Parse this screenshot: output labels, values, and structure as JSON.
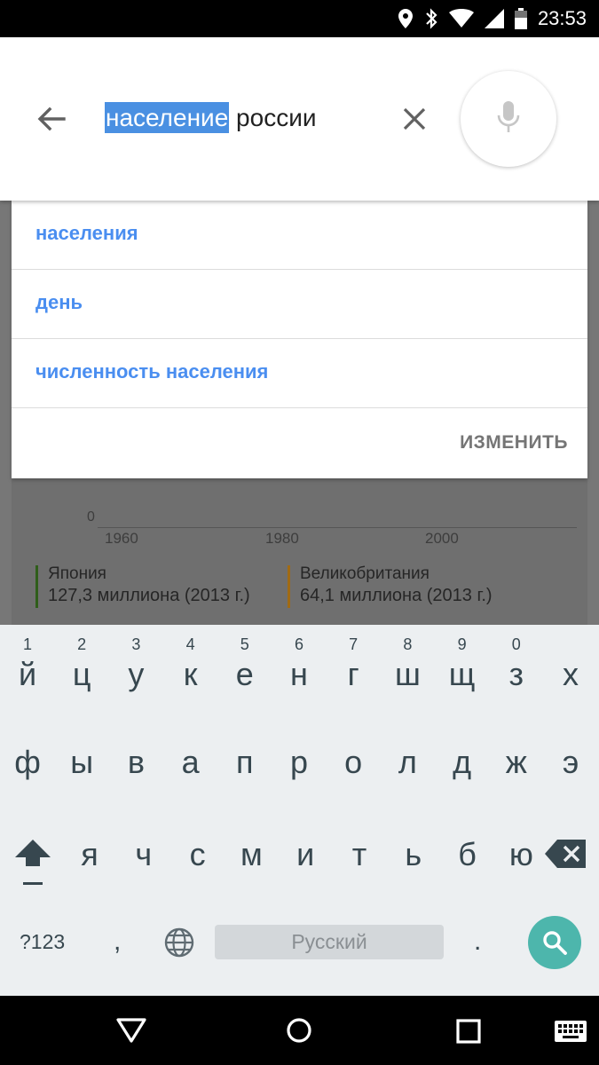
{
  "status_bar": {
    "time": "23:53",
    "icons": [
      "location-icon",
      "bluetooth-icon",
      "wifi-icon",
      "signal-icon",
      "battery-icon"
    ]
  },
  "search": {
    "query_selected": "население",
    "query_rest": " россии",
    "highlight_color": "#4a90e2"
  },
  "suggestions": {
    "items": [
      {
        "label": "населения"
      },
      {
        "label": "день"
      },
      {
        "label": "численность населения"
      }
    ],
    "edit_label": "ИЗМЕНИТЬ",
    "link_color": "#4a8ef0"
  },
  "background_chart": {
    "y_zero_label": "0",
    "x_ticks": [
      "1960",
      "1980",
      "2000"
    ],
    "legend": [
      {
        "name": "Япония",
        "value": "127,3 миллиона (2013 г.)",
        "color": "#2f5e1a"
      },
      {
        "name": "Великобритания",
        "value": "64,1 миллиона (2013 г.)",
        "color": "#a06a14"
      }
    ]
  },
  "keyboard": {
    "row1_hints": [
      "1",
      "2",
      "3",
      "4",
      "5",
      "6",
      "7",
      "8",
      "9",
      "0"
    ],
    "row1": [
      "й",
      "ц",
      "у",
      "к",
      "е",
      "н",
      "г",
      "ш",
      "щ",
      "з",
      "х"
    ],
    "row2": [
      "ф",
      "ы",
      "в",
      "а",
      "п",
      "р",
      "о",
      "л",
      "д",
      "ж",
      "э"
    ],
    "row3": [
      "я",
      "ч",
      "с",
      "м",
      "и",
      "т",
      "ь",
      "б",
      "ю"
    ],
    "symbols_label": "?123",
    "comma_label": ",",
    "space_label": "Русский",
    "period_label": ".",
    "accent_color": "#4db6ac"
  }
}
